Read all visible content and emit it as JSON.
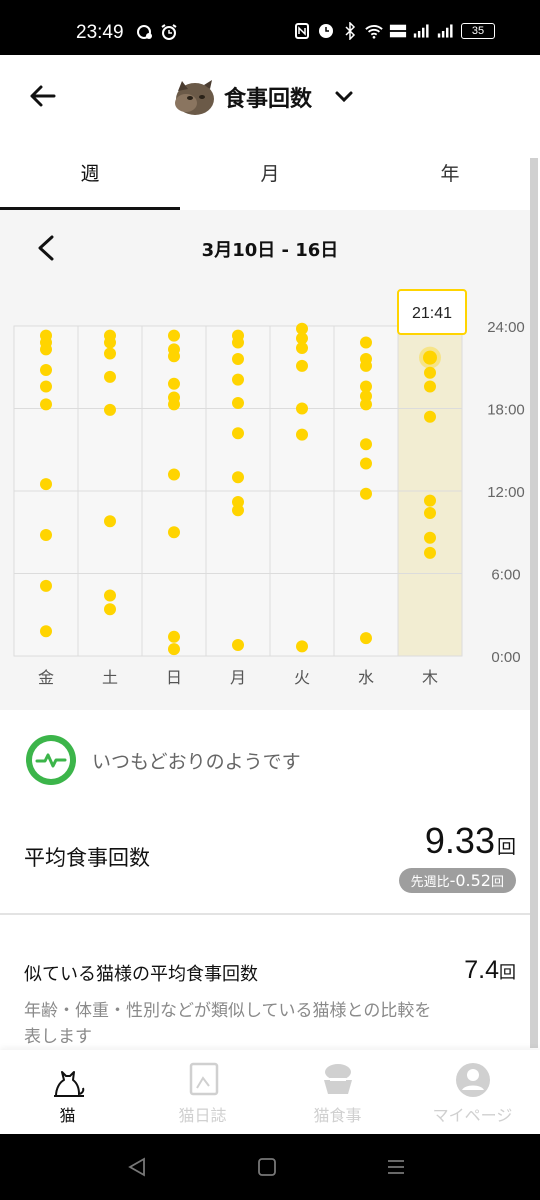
{
  "status_bar": {
    "time": "23:49",
    "battery": "35"
  },
  "header": {
    "title": "食事回数"
  },
  "tabs": [
    {
      "label": "週",
      "active": true
    },
    {
      "label": "月",
      "active": false
    },
    {
      "label": "年",
      "active": false
    }
  ],
  "chart_panel": {
    "week_label": "3月10日 - 16日"
  },
  "chart_data": {
    "type": "scatter",
    "categories": [
      "金",
      "土",
      "日",
      "月",
      "火",
      "水",
      "木"
    ],
    "y_tick_labels": [
      "24:00",
      "18:00",
      "12:00",
      "6:00",
      "0:00"
    ],
    "ylim": [
      0,
      24
    ],
    "highlighted_category": "木",
    "tooltip": "21:41",
    "accent_color": "#FFD400",
    "highlight_bg": "#F2EDD2",
    "series": [
      {
        "category": "金",
        "hours": [
          23.3,
          22.8,
          22.3,
          20.8,
          19.6,
          18.3,
          12.5,
          8.8,
          5.1,
          1.8
        ]
      },
      {
        "category": "土",
        "hours": [
          23.3,
          22.8,
          22.0,
          20.3,
          17.9,
          9.8,
          4.4,
          3.4
        ]
      },
      {
        "category": "日",
        "hours": [
          23.3,
          22.3,
          21.8,
          19.8,
          18.8,
          18.3,
          13.2,
          9.0,
          1.4,
          0.5
        ]
      },
      {
        "category": "月",
        "hours": [
          23.3,
          22.8,
          21.6,
          20.1,
          18.4,
          16.2,
          13.0,
          11.2,
          10.6,
          0.8
        ]
      },
      {
        "category": "火",
        "hours": [
          23.8,
          23.1,
          22.4,
          21.1,
          18.0,
          16.1,
          0.7
        ]
      },
      {
        "category": "水",
        "hours": [
          22.8,
          21.6,
          21.1,
          19.6,
          18.9,
          18.3,
          15.4,
          14.0,
          11.8,
          1.3
        ]
      },
      {
        "category": "木",
        "hours": [
          21.7,
          20.6,
          19.6,
          17.4,
          11.3,
          10.4,
          8.6,
          7.5
        ]
      }
    ]
  },
  "status_message": "いつもどおりのようです",
  "avg": {
    "label": "平均食事回数",
    "value": "9.33",
    "unit": "回",
    "compare_prefix": "先週比",
    "compare_value": "-0.52",
    "compare_unit": "回"
  },
  "similar": {
    "label": "似ている猫様の平均食事回数",
    "value": "7.4",
    "unit": "回",
    "description": "年齢・体重・性別などが類似している猫様との比較を表します"
  },
  "bottom_nav": [
    {
      "label": "猫",
      "icon": "cat-icon",
      "active": true
    },
    {
      "label": "猫日誌",
      "icon": "diary-icon",
      "active": false
    },
    {
      "label": "猫食事",
      "icon": "food-bowl-icon",
      "active": false
    },
    {
      "label": "マイページ",
      "icon": "user-profile-icon",
      "active": false
    }
  ],
  "system_nav": {
    "back": "back-icon",
    "home": "home-icon",
    "recents": "recents-icon"
  }
}
